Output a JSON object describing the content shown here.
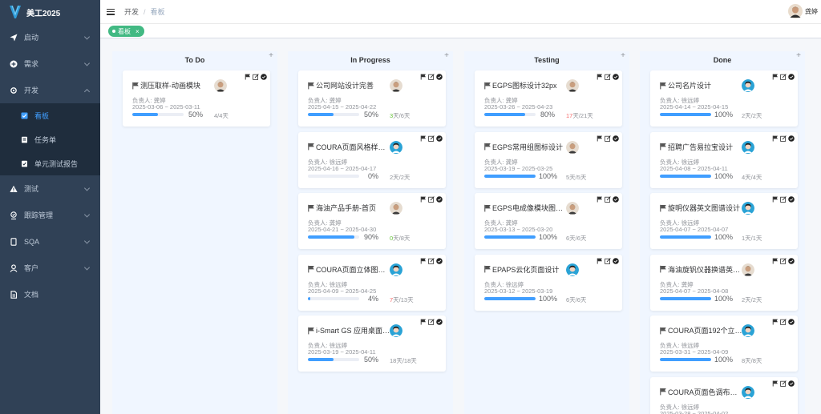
{
  "app": {
    "title": "美工2025"
  },
  "sidebar": {
    "items": [
      {
        "label": "启动",
        "icon": "send-icon",
        "arrow": "down"
      },
      {
        "label": "需求",
        "icon": "plus-circle-icon",
        "arrow": "down"
      },
      {
        "label": "开发",
        "icon": "gear-icon",
        "arrow": "up"
      },
      {
        "label": "测试",
        "icon": "warning-icon",
        "arrow": "down"
      },
      {
        "label": "跟踪管理",
        "icon": "track-icon",
        "arrow": "down"
      },
      {
        "label": "SQA",
        "icon": "tablet-icon",
        "arrow": "down"
      },
      {
        "label": "客户",
        "icon": "user-icon",
        "arrow": "down"
      },
      {
        "label": "文档",
        "icon": "document-icon",
        "arrow": "none"
      }
    ],
    "dev_sub": [
      {
        "label": "看板",
        "icon": "board-icon",
        "active": true
      },
      {
        "label": "任务单",
        "icon": "task-icon",
        "active": false
      },
      {
        "label": "单元测试报告",
        "icon": "report-icon",
        "active": false
      }
    ]
  },
  "header": {
    "breadcrumb": [
      "开发",
      "看板"
    ],
    "user_name": "龚婷"
  },
  "tags": [
    {
      "label": "看板",
      "color": "#42b983"
    }
  ],
  "colors": {
    "sidebar": "#304156",
    "primary": "#409eff",
    "tag": "#42b983",
    "green": "#67c23a",
    "red": "#f56c6c"
  },
  "board": {
    "add_symbol": "+",
    "columns": [
      {
        "title": "To Do",
        "cards": [
          {
            "title": "测压取样-动画模块",
            "owner": "负责人: 龚婷",
            "dates": "2025-03-06 ~ 2025-03-11",
            "progress": 50,
            "pct": "50%",
            "used": "4",
            "total": "/4天",
            "used_color": "gray",
            "avatar": "m"
          }
        ]
      },
      {
        "title": "In Progress",
        "cards": [
          {
            "title": "公司网站设计完善",
            "owner": "负责人: 龚婷",
            "dates": "2025-04-15 ~ 2025-04-22",
            "progress": 50,
            "pct": "50%",
            "used": "3",
            "total": "天/6天",
            "used_color": "green",
            "avatar": "m"
          },
          {
            "title": "COURA页面风格样…",
            "owner": "负责人: 徐远婷",
            "dates": "2025-04-16 ~ 2025-04-17",
            "progress": 0,
            "pct": "0%",
            "used": "2",
            "total": "天/2天",
            "used_color": "gray",
            "avatar": "f"
          },
          {
            "title": "海油产品手册-首页",
            "owner": "负责人: 龚婷",
            "dates": "2025-04-21 ~ 2025-04-30",
            "progress": 90,
            "pct": "90%",
            "used": "0",
            "total": "天/8天",
            "used_color": "green",
            "avatar": "m"
          },
          {
            "title": "COURA页面立体图…",
            "owner": "负责人: 徐远婷",
            "dates": "2025-04-09 ~ 2025-04-25",
            "progress": 4,
            "pct": "4%",
            "used": "7",
            "total": "天/13天",
            "used_color": "red",
            "avatar": "f"
          },
          {
            "title": "i-Smart GS 应用桌面…",
            "owner": "负责人: 徐远婷",
            "dates": "2025-03-19 ~ 2025-04-11",
            "progress": 50,
            "pct": "50%",
            "used": "18",
            "total": "天/18天",
            "used_color": "gray",
            "avatar": "f"
          }
        ]
      },
      {
        "title": "Testing",
        "cards": [
          {
            "title": "EGPS图标设计32px",
            "owner": "负责人: 龚婷",
            "dates": "2025-03-26 ~ 2025-04-23",
            "progress": 80,
            "pct": "80%",
            "used": "17",
            "total": "天/21天",
            "used_color": "red",
            "avatar": "m"
          },
          {
            "title": "EGPS常用组图标设计",
            "owner": "负责人: 龚婷",
            "dates": "2025-03-19 ~ 2025-03-25",
            "progress": 100,
            "pct": "100%",
            "used": "5",
            "total": "天/5天",
            "used_color": "gray",
            "avatar": "m"
          },
          {
            "title": "EGPS电成像模块图…",
            "owner": "负责人: 龚婷",
            "dates": "2025-03-13 ~ 2025-03-20",
            "progress": 100,
            "pct": "100%",
            "used": "6",
            "total": "天/6天",
            "used_color": "gray",
            "avatar": "m"
          },
          {
            "title": "EPAPS云化页面设计",
            "owner": "负责人: 徐远婷",
            "dates": "2025-03-12 ~ 2025-03-19",
            "progress": 100,
            "pct": "100%",
            "used": "6",
            "total": "天/6天",
            "used_color": "gray",
            "avatar": "f"
          }
        ]
      },
      {
        "title": "Done",
        "cards": [
          {
            "title": "公司名片设计",
            "owner": "负责人: 徐远婷",
            "dates": "2025-04-14 ~ 2025-04-15",
            "progress": 100,
            "pct": "100%",
            "used": "2",
            "total": "天/2天",
            "used_color": "gray",
            "avatar": "f"
          },
          {
            "title": "招聘广告易拉宝设计",
            "owner": "负责人: 徐远婷",
            "dates": "2025-04-08 ~ 2025-04-11",
            "progress": 100,
            "pct": "100%",
            "used": "4",
            "total": "天/4天",
            "used_color": "gray",
            "avatar": "f"
          },
          {
            "title": "旋明仪器英文图谱设计",
            "owner": "负责人: 徐远婷",
            "dates": "2025-04-07 ~ 2025-04-07",
            "progress": 100,
            "pct": "100%",
            "used": "1",
            "total": "天/1天",
            "used_color": "gray",
            "avatar": "f"
          },
          {
            "title": "海油旋钒仪器换谱英…",
            "owner": "负责人: 龚婷",
            "dates": "2025-04-07 ~ 2025-04-08",
            "progress": 100,
            "pct": "100%",
            "used": "2",
            "total": "天/2天",
            "used_color": "gray",
            "avatar": "m"
          },
          {
            "title": "COURA页面192个立…",
            "owner": "负责人: 徐远婷",
            "dates": "2025-03-31 ~ 2025-04-09",
            "progress": 100,
            "pct": "100%",
            "used": "8",
            "total": "天/8天",
            "used_color": "gray",
            "avatar": "f"
          },
          {
            "title": "COURA页面色调布…",
            "owner": "负责人: 徐远婷",
            "dates": "2025-03-28 ~ 2025-04-02",
            "progress": 100,
            "pct": "100%",
            "used": "",
            "total": "",
            "used_color": "gray",
            "avatar": "f"
          }
        ]
      }
    ]
  }
}
